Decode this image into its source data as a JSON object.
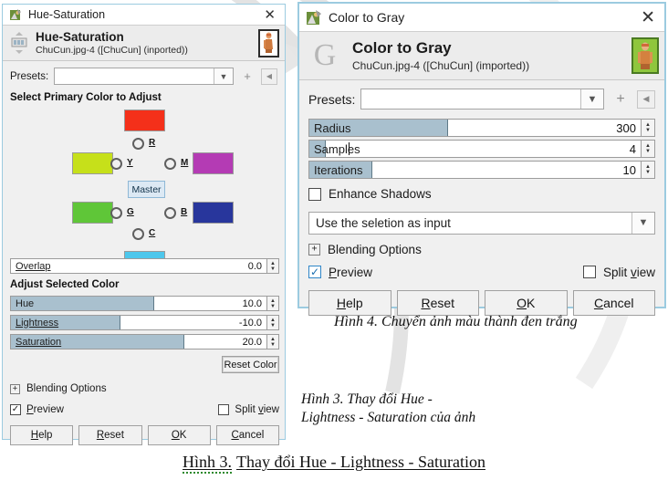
{
  "hue_saturation": {
    "titlebar": {
      "title": "Hue-Saturation",
      "close_icon": "close-icon",
      "app_icon": "gimp-tool-icon"
    },
    "header": {
      "title": "Hue-Saturation",
      "subtitle": "ChuCun.jpg-4 ([ChuCun] (inported))",
      "preview_thumb": "image-thumbnail"
    },
    "presets": {
      "label": "Presets:",
      "value": "",
      "dropdown_icon": "chevron-down-icon",
      "add_icon": "plus-icon",
      "menu_icon": "preset-menu-icon"
    },
    "primary_color_section": "Select Primary Color to Adjust",
    "color_options": [
      {
        "key": "R",
        "label": "R",
        "color": "#f4301a"
      },
      {
        "key": "Y",
        "label": "Y",
        "color": "#c6e01a"
      },
      {
        "key": "M",
        "label": "M",
        "color": "#b43bb4"
      },
      {
        "key": "G",
        "label": "G",
        "color": "#5fc638"
      },
      {
        "key": "B",
        "label": "B",
        "color": "#28369c"
      },
      {
        "key": "C",
        "label": "C",
        "color": "#4dc7ec"
      }
    ],
    "master_label": "Master",
    "overlap": {
      "label": "Overlap",
      "value": "0.0",
      "fill_pct": 0
    },
    "adjust_section": "Adjust Selected Color",
    "sliders": [
      {
        "label": "Hue",
        "value": "10.0",
        "fill_pct": 56
      },
      {
        "label": "Lightness",
        "value": "-10.0",
        "fill_pct": 43
      },
      {
        "label": "Saturation",
        "value": "20.0",
        "fill_pct": 68
      }
    ],
    "reset_color_label": "Reset Color",
    "blending_options": "Blending Options",
    "preview": {
      "label": "Preview",
      "checked": true
    },
    "split_view": {
      "label": "Split view",
      "checked": false
    },
    "buttons": [
      "Help",
      "Reset",
      "OK",
      "Cancel"
    ]
  },
  "color_to_gray": {
    "titlebar": {
      "title": "Color to Gray",
      "close_icon": "close-icon",
      "app_icon": "gimp-tool-icon"
    },
    "header": {
      "title": "Color to Gray",
      "subtitle": "ChuCun.jpg-4 ([ChuCun] (imported))",
      "logo_letter": "G",
      "preview_thumb": "image-thumbnail"
    },
    "presets": {
      "label": "Presets:",
      "value": "",
      "dropdown_icon": "chevron-down-icon",
      "add_icon": "plus-icon",
      "menu_icon": "preset-menu-icon"
    },
    "sliders": [
      {
        "label": "Radius",
        "value": "300",
        "fill_pct": 42
      },
      {
        "label": "Samples",
        "value": "4",
        "fill_pct": 5
      },
      {
        "label": "Iterations",
        "value": "10",
        "fill_pct": 19
      }
    ],
    "enhance_shadows": {
      "label": "Enhance Shadows",
      "checked": false
    },
    "input_select": {
      "value": "Use the seletion as input",
      "dropdown_icon": "chevron-down-icon"
    },
    "blending_options": "Blending Options",
    "preview": {
      "label": "Preview",
      "checked": true
    },
    "split_view": {
      "label": "Split view",
      "checked": false
    },
    "buttons": [
      "Help",
      "Reset",
      "OK",
      "Cancel"
    ]
  },
  "captions": {
    "fig4": "Hình 4. Chuyển ảnh màu thành đen trắng",
    "fig3_inline_line1": "Hình 3. Thay đổi Hue -",
    "fig3_inline_line2": "Lightness - Saturation của ảnh",
    "fig3_bottom_prefix": "Hình 3.",
    "fig3_bottom_rest": "Thay đổi Hue - Lightness - Saturation"
  },
  "colors": {
    "dialog_border": "#9ccbe0",
    "slider_fill": "#a9c0ce",
    "dialog_bg": "#f0f0f0",
    "accent_check": "#1c6fb0"
  }
}
